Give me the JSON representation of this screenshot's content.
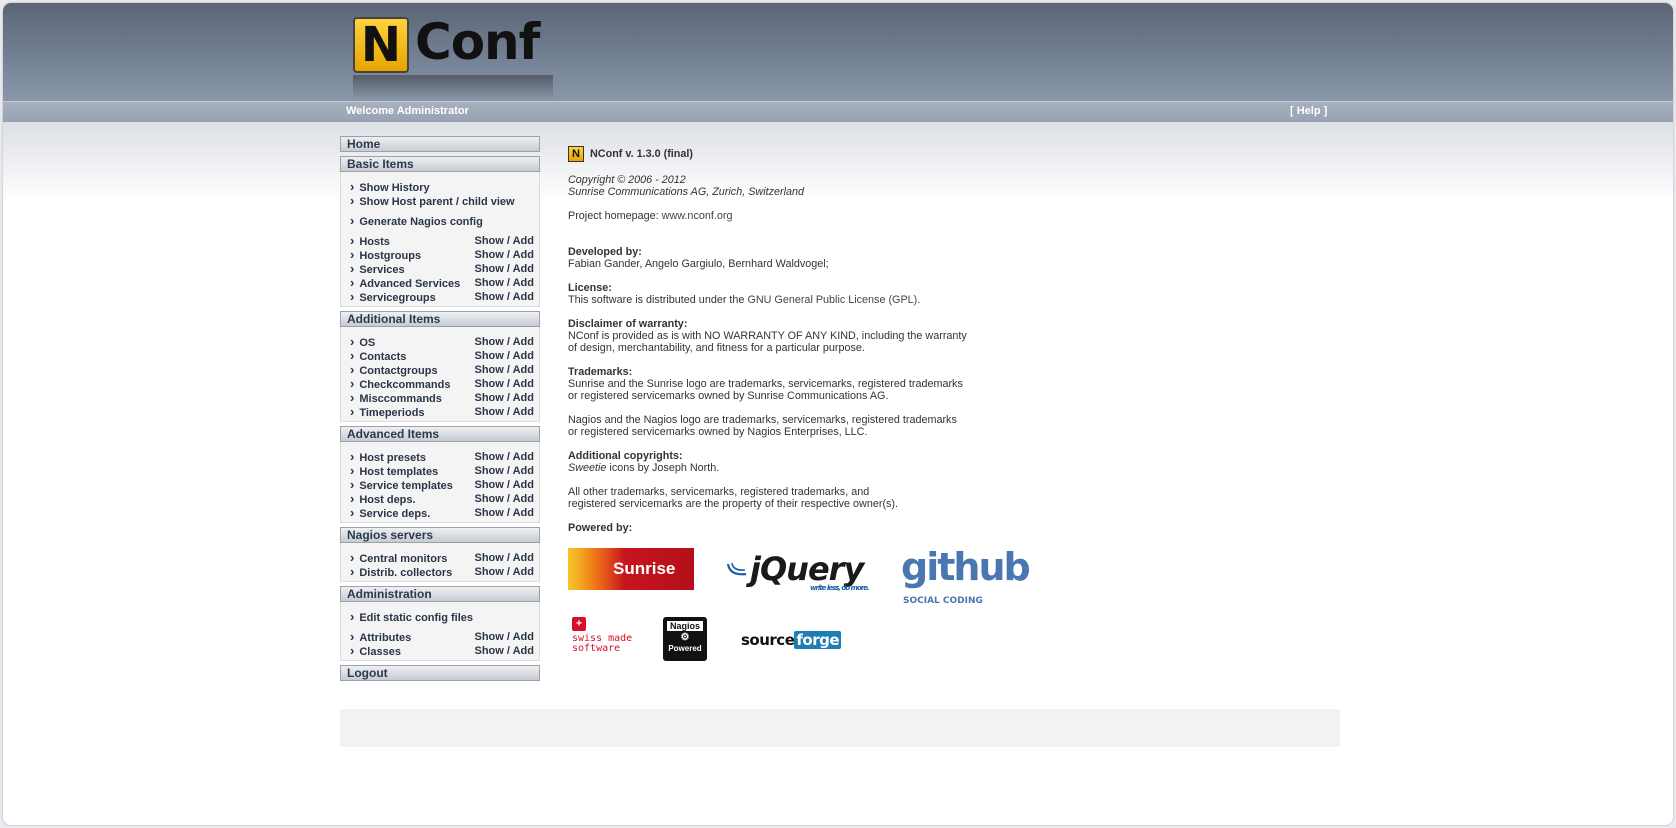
{
  "header": {
    "logo_letter": "N",
    "logo_text": "Conf",
    "welcome": "Welcome Administrator",
    "help": "[ Help ]"
  },
  "sidebar": {
    "home": "Home",
    "basic": {
      "title": "Basic Items",
      "show_history": "Show History",
      "show_host_parent": "Show Host parent / child view",
      "generate": "Generate Nagios config",
      "items": [
        {
          "label": "Hosts",
          "show": "Show",
          "add": "Add"
        },
        {
          "label": "Hostgroups",
          "show": "Show",
          "add": "Add"
        },
        {
          "label": "Services",
          "show": "Show",
          "add": "Add"
        },
        {
          "label": "Advanced Services",
          "show": "Show",
          "add": "Add"
        },
        {
          "label": "Servicegroups",
          "show": "Show",
          "add": "Add"
        }
      ]
    },
    "additional": {
      "title": "Additional Items",
      "items": [
        {
          "label": "OS",
          "show": "Show",
          "add": "Add"
        },
        {
          "label": "Contacts",
          "show": "Show",
          "add": "Add"
        },
        {
          "label": "Contactgroups",
          "show": "Show",
          "add": "Add"
        },
        {
          "label": "Checkcommands",
          "show": "Show",
          "add": "Add"
        },
        {
          "label": "Misccommands",
          "show": "Show",
          "add": "Add"
        },
        {
          "label": "Timeperiods",
          "show": "Show",
          "add": "Add"
        }
      ]
    },
    "advanced": {
      "title": "Advanced Items",
      "items": [
        {
          "label": "Host presets",
          "show": "Show",
          "add": "Add"
        },
        {
          "label": "Host templates",
          "show": "Show",
          "add": "Add"
        },
        {
          "label": "Service templates",
          "show": "Show",
          "add": "Add"
        },
        {
          "label": "Host deps.",
          "show": "Show",
          "add": "Add"
        },
        {
          "label": "Service deps.",
          "show": "Show",
          "add": "Add"
        }
      ]
    },
    "nagios": {
      "title": "Nagios servers",
      "items": [
        {
          "label": "Central monitors",
          "show": "Show",
          "add": "Add"
        },
        {
          "label": "Distrib. collectors",
          "show": "Show",
          "add": "Add"
        }
      ]
    },
    "admin": {
      "title": "Administration",
      "edit_static": "Edit static config files",
      "items": [
        {
          "label": "Attributes",
          "show": "Show",
          "add": "Add"
        },
        {
          "label": "Classes",
          "show": "Show",
          "add": "Add"
        }
      ]
    },
    "logout": "Logout",
    "separator": " / "
  },
  "main": {
    "version": "NConf v. 1.3.0 (final)",
    "copyright_line1": "Copyright © 2006 - 2012",
    "copyright_line2": "Sunrise Communications AG, Zurich, Switzerland",
    "homepage_label": "Project homepage: ",
    "homepage_link": "www.nconf.org",
    "developed_title": "Developed by:",
    "developed_text": "Fabian Gander, Angelo Gargiulo, Bernhard Waldvogel;",
    "license_title": "License:",
    "license_text": "This software is distributed under the ",
    "license_link": "GNU General Public License (GPL).",
    "disclaimer_title": "Disclaimer of warranty:",
    "disclaimer_line1": "NConf is provided as is with NO WARRANTY OF ANY KIND, including the warranty",
    "disclaimer_line2": "of design, merchantability, and fitness for a particular purpose.",
    "trademarks_title": "Trademarks:",
    "trademarks_line1": "Sunrise and the Sunrise logo are trademarks, servicemarks, registered trademarks",
    "trademarks_line2": "or registered servicemarks owned by Sunrise Communications AG.",
    "nagios_line1": "Nagios and the Nagios logo are trademarks, servicemarks, registered trademarks",
    "nagios_line2": "or registered servicemarks owned by Nagios Enterprises, LLC.",
    "addl_title": "Additional copyrights:",
    "addl_italic": "Sweetie",
    "addl_rest": " icons by Joseph North.",
    "other_line1": "All other trademarks, servicemarks, registered trademarks, and",
    "other_line2": "registered servicemarks are the property of their respective owner(s).",
    "powered_title": "Powered by:"
  },
  "logos": {
    "sunrise": "Sunrise",
    "jquery": "jQuery",
    "jquery_tagline": "write less, do more.",
    "github": "github",
    "github_tagline": "SOCIAL CODING",
    "swiss_line1": "swiss made",
    "swiss_line2": "software",
    "nagios_top": "Nagios",
    "nagios_bottom": "Powered",
    "sourceforge_a": "source",
    "sourceforge_b": "forge"
  }
}
